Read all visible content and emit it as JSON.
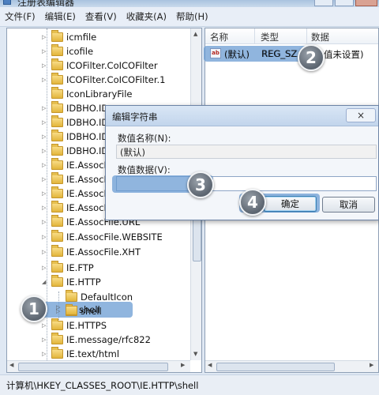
{
  "window": {
    "title": "注册表编辑器"
  },
  "menu": [
    "文件(F)",
    "编辑(E)",
    "查看(V)",
    "收藏夹(A)",
    "帮助(H)"
  ],
  "tree": {
    "items": [
      {
        "label": "icmfile"
      },
      {
        "label": "icofile"
      },
      {
        "label": "ICOFilter.CoICOFilter"
      },
      {
        "label": "ICOFilter.CoICOFilter.1"
      },
      {
        "label": "IconLibraryFile"
      },
      {
        "label": "IDBHO.ID"
      },
      {
        "label": "IDBHO.ID"
      },
      {
        "label": "IDBHO.ID"
      },
      {
        "label": "IDBHO.ID"
      },
      {
        "label": "IE.AssocFi"
      },
      {
        "label": "IE.AssocFi"
      },
      {
        "label": "IE.AssocFi"
      },
      {
        "label": "IE.AssocFi"
      },
      {
        "label": "IE.AssocFile.URL"
      },
      {
        "label": "IE.AssocFile.WEBSITE"
      },
      {
        "label": "IE.AssocFile.XHT"
      },
      {
        "label": "IE.FTP"
      },
      {
        "label": "IE.HTTP"
      },
      {
        "label": "DefaultIcon"
      },
      {
        "label": "shell"
      },
      {
        "label": "IE.HTTPS"
      },
      {
        "label": "IE.message/rfc822"
      },
      {
        "label": "IE.text/html"
      }
    ]
  },
  "list": {
    "columns": [
      "名称",
      "类型",
      "数据"
    ],
    "rows": [
      {
        "name": "(默认)",
        "type": "REG_SZ",
        "data": "(数值未设置)"
      }
    ]
  },
  "status": {
    "path": "计算机\\HKEY_CLASSES_ROOT\\IE.HTTP\\shell"
  },
  "dialog": {
    "title": "编辑字符串",
    "close_glyph": "×",
    "name_label": "数值名称(N):",
    "name_value": "(默认)",
    "data_label": "数值数据(V):",
    "data_value": "",
    "ok_label": "确定",
    "cancel_label": "取消"
  },
  "steps": [
    "1",
    "2",
    "3",
    "4"
  ],
  "colors": {
    "highlight": "#6599d1",
    "badge": "#6e7780"
  }
}
